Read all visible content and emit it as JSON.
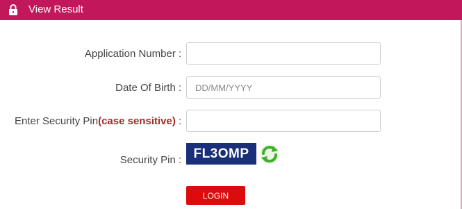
{
  "header": {
    "title": "View Result",
    "background_color": "#c2185b",
    "icon": "lock-icon"
  },
  "form": {
    "application_number": {
      "label": "Application Number",
      "separator": ":",
      "value": "",
      "placeholder": ""
    },
    "date_of_birth": {
      "label": "Date Of Birth",
      "separator": ":",
      "value": "",
      "placeholder": "DD/MM/YYYY"
    },
    "security_pin_input": {
      "label": "Enter Security Pin",
      "label_hint": "(case sensitive)",
      "separator": ":",
      "value": "",
      "placeholder": ""
    },
    "security_pin": {
      "label": "Security Pin",
      "separator": ":",
      "captcha_text": "FL3OMP",
      "refresh_icon": "refresh-icon"
    },
    "login_label": "LOGIN",
    "login_color": "#dd0b0b"
  }
}
